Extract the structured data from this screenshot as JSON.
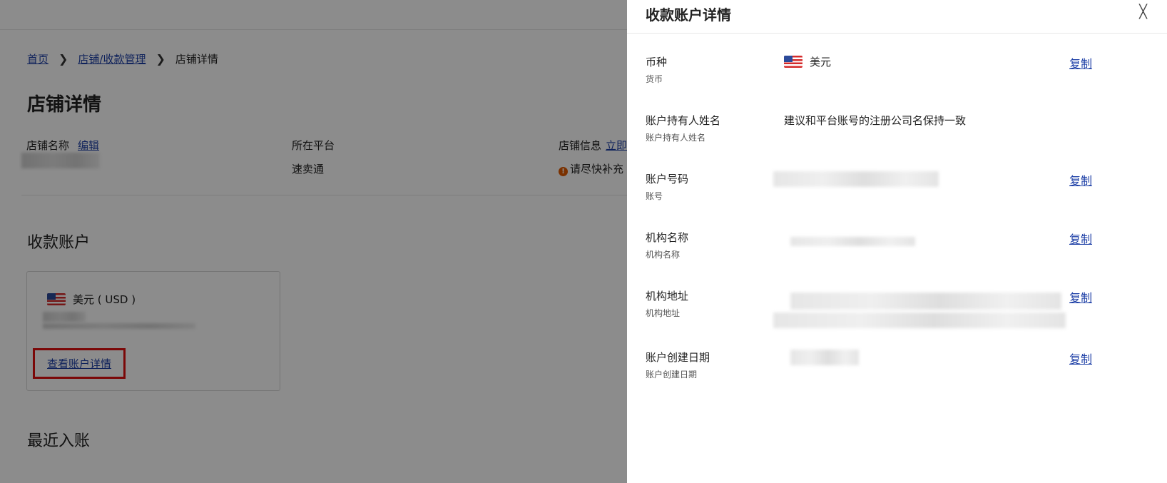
{
  "breadcrumb": {
    "home": "首页",
    "store_mgmt": "店铺/收款管理",
    "current": "店铺详情",
    "separator": "❯"
  },
  "page_title": "店铺详情",
  "store_info": {
    "name_label": "店铺名称",
    "edit_link": "编辑",
    "platform_label": "所在平台",
    "platform_value": "速卖通",
    "info_label": "店铺信息",
    "info_link": "立即",
    "warning_icon": "!",
    "warning_text": "请尽快补充"
  },
  "receiving_account": {
    "section_title": "收款账户",
    "card_currency": "美元 ( USD )",
    "view_details_link": "查看账户详情"
  },
  "recent_entries": {
    "section_title": "最近入账"
  },
  "drawer": {
    "title": "收款账户详情",
    "close_icon": "╳",
    "rows": [
      {
        "label": "币种",
        "sub": "货币",
        "value": "美元",
        "copy": "复制"
      },
      {
        "label": "账户持有人姓名",
        "sub": "账户持有人姓名",
        "value": "建议和平台账号的注册公司名保持一致"
      },
      {
        "label": "账户号码",
        "sub": "账号",
        "copy": "复制"
      },
      {
        "label": "机构名称",
        "sub": "机构名称",
        "copy": "复制"
      },
      {
        "label": "机构地址",
        "sub": "机构地址",
        "copy": "复制"
      },
      {
        "label": "账户创建日期",
        "sub": "账户创建日期",
        "copy": "复制"
      }
    ]
  },
  "icons": [
    "us-flag-icon",
    "warning-icon",
    "close-icon",
    "chevron-right-icon"
  ],
  "colors": {
    "link": "#1d3fa6",
    "highlight": "#e01010",
    "warning": "#e05a00",
    "overlay": "rgba(0,0,0,0.45)"
  }
}
